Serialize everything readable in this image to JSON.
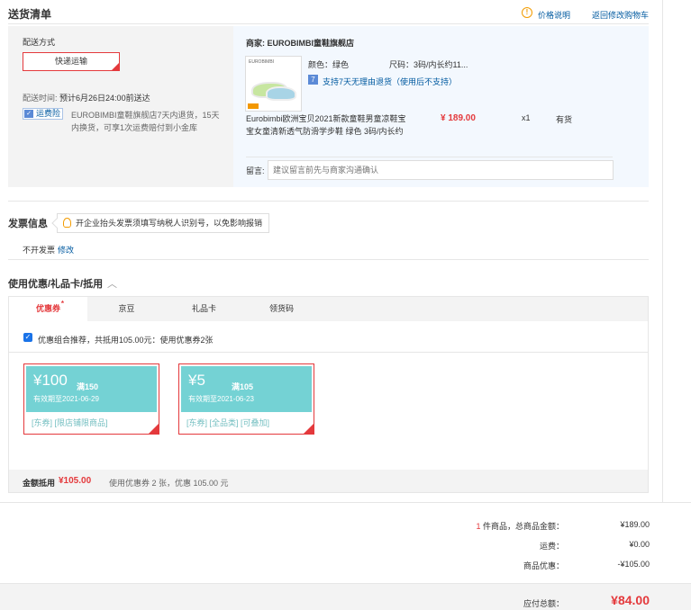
{
  "header": {
    "title": "送货清单",
    "price_explain": "价格说明",
    "back_to_cart": "返回修改购物车"
  },
  "shipping": {
    "label": "配送方式",
    "method": "快递运输",
    "time_label": "配送时间:",
    "time_value": "预计6月26日24:00前送达",
    "freight_tag": "运费险",
    "freight_desc": "EUROBIMBI童鞋旗舰店7天内退货，15天内换货，可享1次运费赔付到小金库"
  },
  "shop": {
    "name": "商家: EUROBIMBI童鞋旗舰店",
    "product": {
      "title": "Eurobimbi欧洲宝贝2021新款童鞋男童凉鞋宝宝女童清新透气防滑学步鞋 绿色 3码/内长约",
      "color": "颜色：绿色",
      "size": "尺码：3码/内长约11...",
      "return_policy": "支持7天无理由退货（使用后不支持）",
      "price": "¥ 189.00",
      "qty": "x1",
      "stock": "有货",
      "image_brand": "EUROBIMBI"
    },
    "note_label": "留言:",
    "note_placeholder": "建议留言前先与商家沟通确认"
  },
  "invoice": {
    "title": "发票信息",
    "tip": "开企业抬头发票须填写纳税人识别号，以免影响报销",
    "status": "不开发票",
    "edit": "修改"
  },
  "coupons": {
    "title": "使用优惠/礼品卡/抵用",
    "tabs": [
      {
        "label": "优惠券",
        "active": true,
        "dot": "*"
      },
      {
        "label": "京豆",
        "active": false
      },
      {
        "label": "礼品卡",
        "active": false
      },
      {
        "label": "领货码",
        "active": false
      }
    ],
    "recommend_text": "优惠组合推荐，共抵用105.00元：使用优惠券2张",
    "items": [
      {
        "amount": "¥100",
        "condition": "满150",
        "expiry": "有效期至2021-06-29",
        "tags": "[东券] [限店铺限商品]"
      },
      {
        "amount": "¥5",
        "condition": "满105",
        "expiry": "有效期至2021-06-23",
        "tags": "[东券] [全品类] [可叠加]"
      }
    ],
    "footer_label": "金额抵用",
    "footer_amount": "¥105.00",
    "footer_desc": "使用优惠券 2 张，优惠 105.00 元"
  },
  "summary": {
    "count": "1",
    "count_suffix": " 件商品，总商品金额：",
    "total": "¥189.00",
    "shipping_label": "运费：",
    "shipping": "¥0.00",
    "discount_label": "商品优惠：",
    "discount": "-¥105.00",
    "pay_label": "应付总额：",
    "pay": "¥84.00"
  },
  "colors": {
    "accent_red": "#e4393c",
    "link_blue": "#005aa0",
    "coupon_teal": "#74d2d4"
  }
}
